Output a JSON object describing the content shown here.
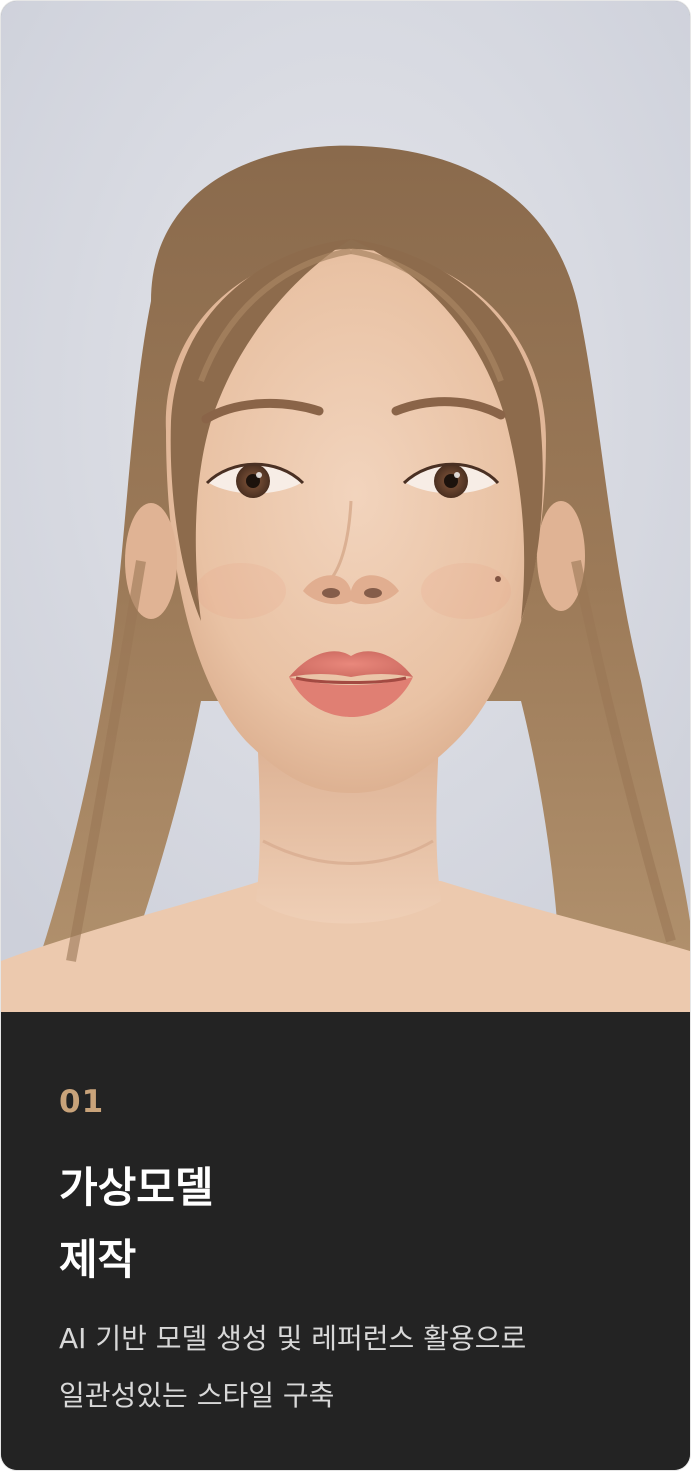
{
  "card": {
    "step_number": "01",
    "title_lines": [
      "가상모델",
      "제작"
    ],
    "description_lines": [
      "AI 기반 모델 생성 및 레퍼런스 활용으로",
      "일관성있는 스타일 구축"
    ],
    "accent_color": "#c9a37a",
    "background_color": "#232323"
  },
  "image": {
    "icon": "virtual-model-portrait"
  }
}
